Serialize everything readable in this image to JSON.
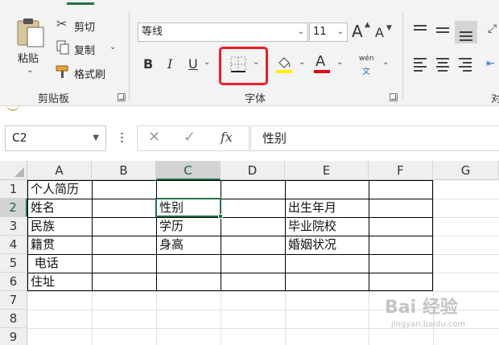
{
  "ribbon": {
    "clipboard": {
      "paste": "粘贴",
      "cut": "剪切",
      "copy": "复制",
      "format_painter": "格式刷",
      "group_label": "剪贴板"
    },
    "font": {
      "font_name": "等线",
      "font_size": "11",
      "bold": "B",
      "italic": "I",
      "underline": "U",
      "font_color_letter": "A",
      "phonetic_top": "wén",
      "phonetic_bottom": "文",
      "group_label": "字体",
      "grow": "A",
      "shrink": "A"
    },
    "alignment": {
      "group_label_partial": "对"
    }
  },
  "formula_bar": {
    "name_box": "C2",
    "fx": "fx",
    "value": "性别"
  },
  "sheet": {
    "columns": [
      "A",
      "B",
      "C",
      "D",
      "E",
      "F",
      "G"
    ],
    "rows": [
      "1",
      "2",
      "3",
      "4",
      "5",
      "6",
      "7",
      "8",
      "9"
    ],
    "cells": {
      "A1": "个人简历",
      "A2": "姓名",
      "A3": "民族",
      "A4": "籍贯",
      "A5": " 电话",
      "A6": "住址",
      "C2": "性别",
      "C3": "学历",
      "C4": "身高",
      "E2": "出生年月",
      "E3": "毕业院校",
      "E4": "婚姻状况"
    },
    "selected_cell": "C2"
  },
  "watermark": {
    "main": "Bai 经验",
    "sub": "jingyan.baidu.com"
  },
  "colors": {
    "accent": "#217346",
    "highlight": "#e8202a",
    "fill_yellow": "#ffee00",
    "font_red": "#e3001b"
  }
}
